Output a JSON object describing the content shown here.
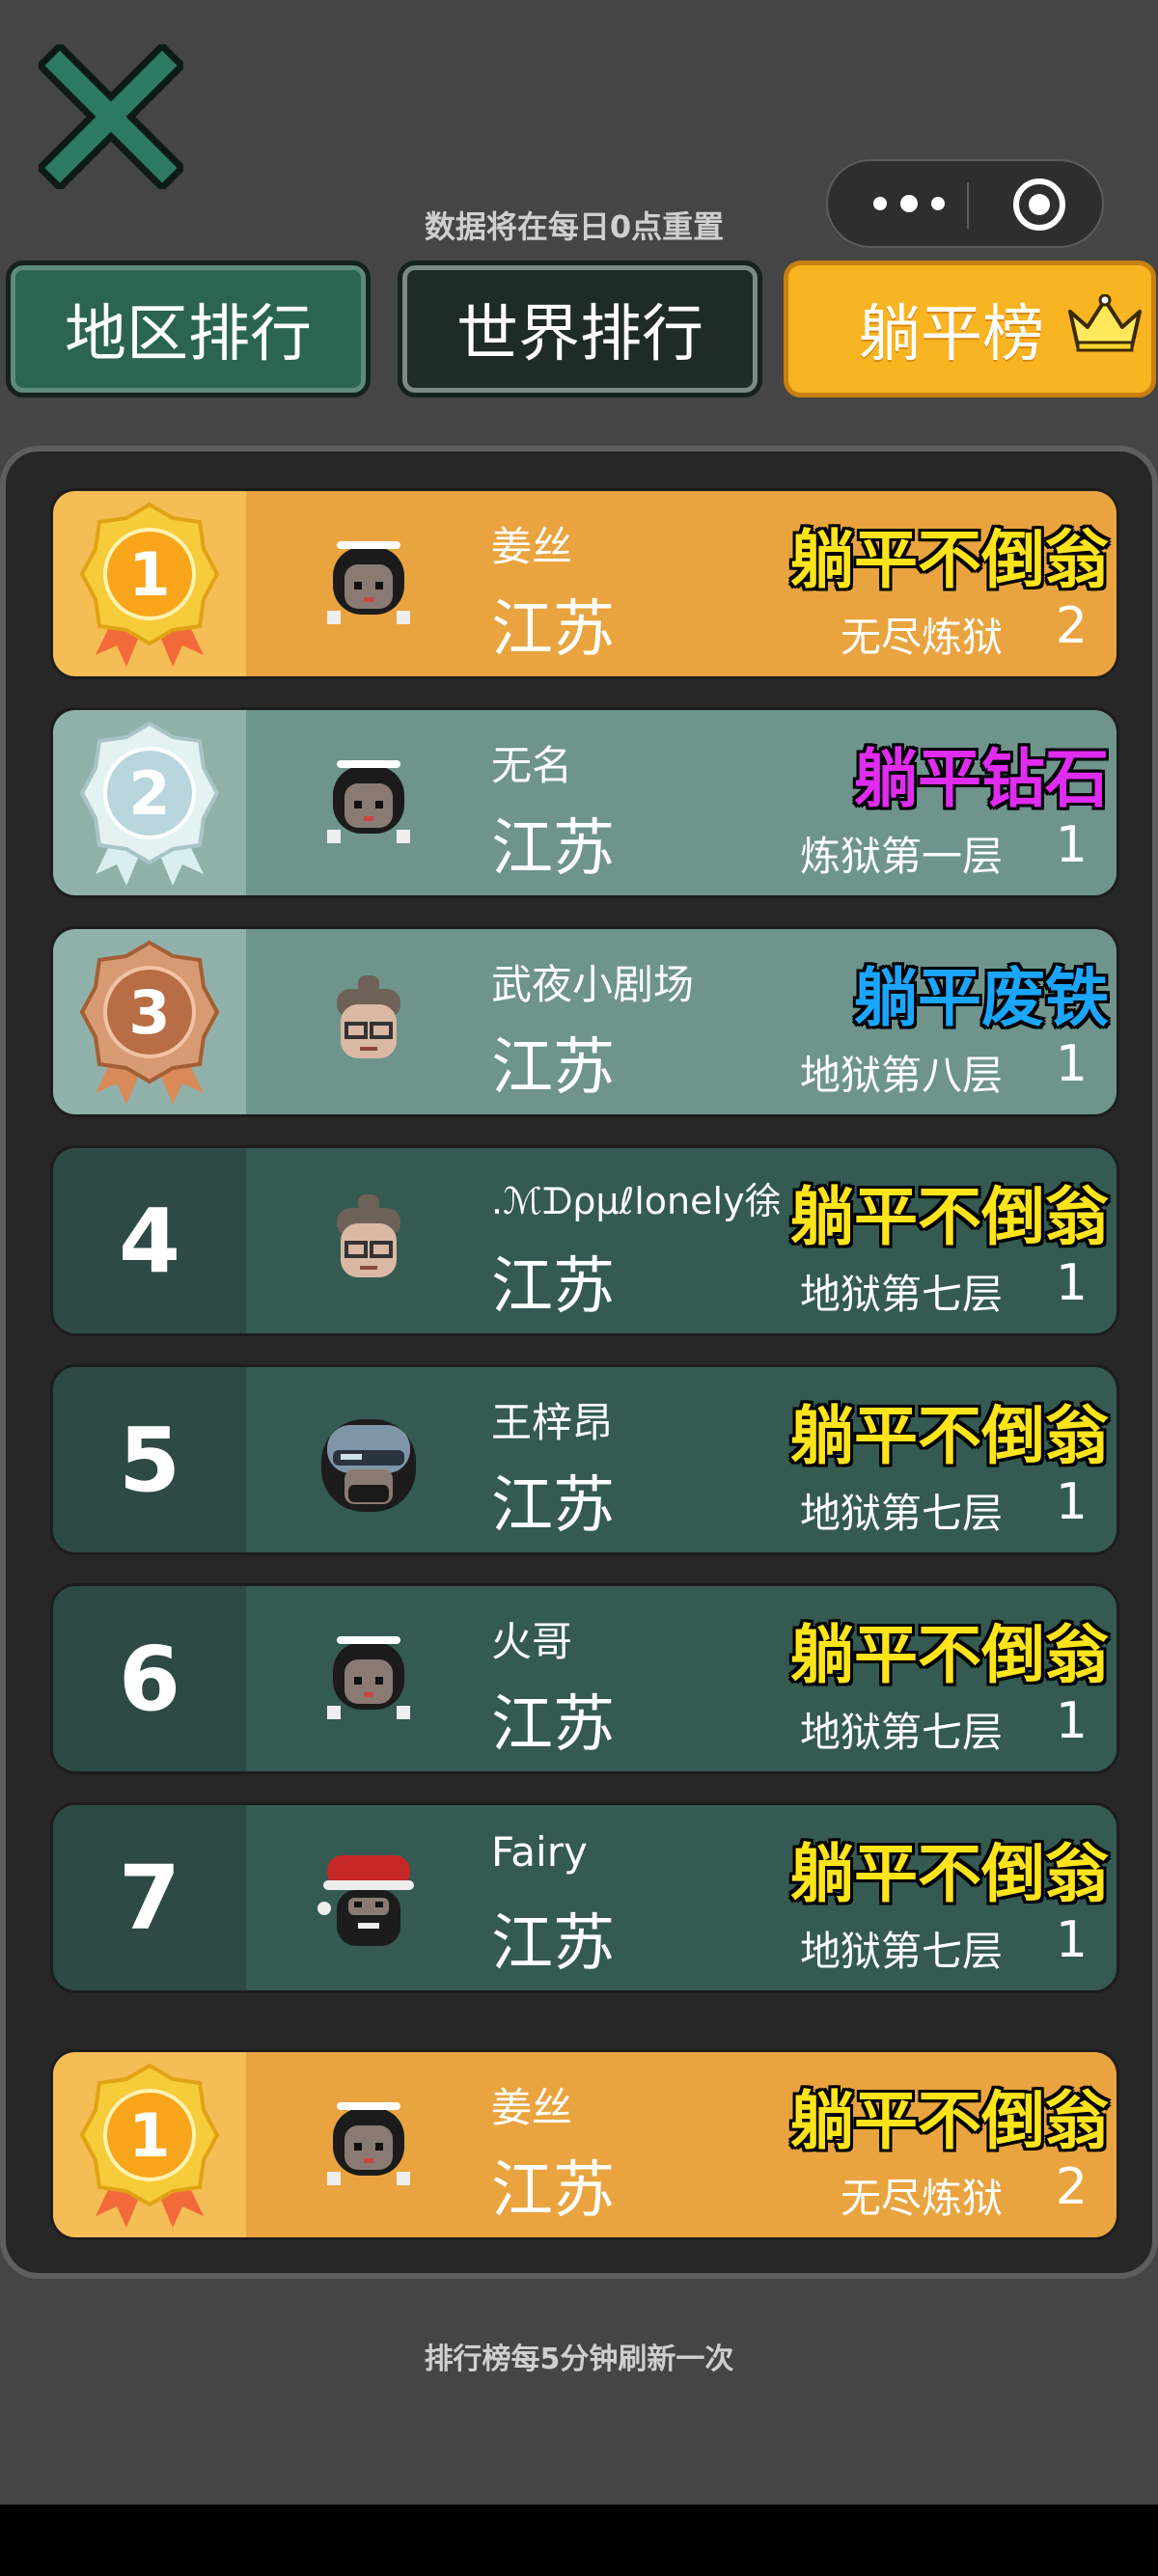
{
  "header": {
    "reset_note": "数据将在每日0点重置"
  },
  "tabs": [
    {
      "label": "地区排行",
      "active": false
    },
    {
      "label": "世界排行",
      "active": false
    },
    {
      "label": "躺平榜",
      "active": true
    }
  ],
  "rows": [
    {
      "rank": "1",
      "name": "姜丝",
      "region": "江苏",
      "title": "躺平不倒翁",
      "level": "无尽炼狱",
      "count": "2",
      "avatar": "girl-avatar"
    },
    {
      "rank": "2",
      "name": "无名",
      "region": "江苏",
      "title": "躺平钻石",
      "level": "炼狱第一层",
      "count": "1",
      "avatar": "girl-avatar"
    },
    {
      "rank": "3",
      "name": "武夜小剧场",
      "region": "江苏",
      "title": "躺平废铁",
      "level": "地狱第八层",
      "count": "1",
      "avatar": "grandma-avatar"
    },
    {
      "rank": "4",
      "name": ".ℳᗪρμℓlonely徐",
      "region": "江苏",
      "title": "躺平不倒翁",
      "level": "地狱第七层",
      "count": "1",
      "avatar": "grandma-avatar"
    },
    {
      "rank": "5",
      "name": "王梓昂",
      "region": "江苏",
      "title": "躺平不倒翁",
      "level": "地狱第七层",
      "count": "1",
      "avatar": "helmet-avatar"
    },
    {
      "rank": "6",
      "name": "火哥",
      "region": "江苏",
      "title": "躺平不倒翁",
      "level": "地狱第七层",
      "count": "1",
      "avatar": "girl-avatar"
    },
    {
      "rank": "7",
      "name": "Fairy",
      "region": "江苏",
      "title": "躺平不倒翁",
      "level": "地狱第七层",
      "count": "1",
      "avatar": "santa-avatar"
    }
  ],
  "my_row": {
    "rank": "1",
    "name": "姜丝",
    "region": "江苏",
    "title": "躺平不倒翁",
    "level": "无尽炼狱",
    "count": "2",
    "avatar": "girl-avatar"
  },
  "footer": {
    "refresh_note": "排行榜每5分钟刷新一次"
  },
  "colors": {
    "title_yellow": "#ffe41a",
    "title_purple": "#e02cf0",
    "title_blue": "#1aa6ff",
    "gold": "#e9a43f",
    "silver_teal": "#6e948c",
    "dark_teal": "#345a52",
    "tab_active": "#f9b422"
  }
}
